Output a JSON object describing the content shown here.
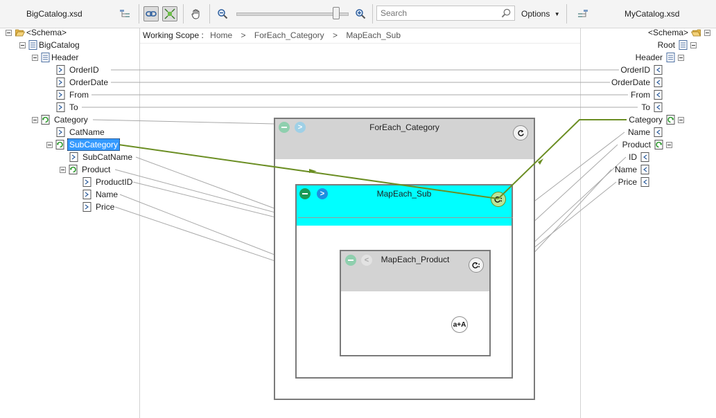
{
  "toolbar": {
    "left_schema_file": "BigCatalog.xsd",
    "right_schema_file": "MyCatalog.xsd",
    "search_placeholder": "Search",
    "options_label": "Options",
    "zoom_level": 0.9
  },
  "scope": {
    "label": "Working Scope :",
    "crumbs": [
      "Home",
      "ForEach_Category",
      "MapEach_Sub"
    ]
  },
  "left_tree": {
    "schema": "<Schema>",
    "root": "BigCatalog",
    "header": "Header",
    "order_id": "OrderID",
    "order_date": "OrderDate",
    "from": "From",
    "to": "To",
    "category": "Category",
    "cat_name": "CatName",
    "sub_category": "SubCategory",
    "sub_cat_name": "SubCatName",
    "product": "Product",
    "product_id": "ProductID",
    "name": "Name",
    "price": "Price"
  },
  "right_tree": {
    "schema": "<Schema>",
    "root": "Root",
    "header": "Header",
    "order_id": "OrderID",
    "order_date": "OrderDate",
    "from": "From",
    "to": "To",
    "category": "Category",
    "name": "Name",
    "product": "Product",
    "id": "ID",
    "product_name": "Name",
    "price": "Price"
  },
  "shapes": {
    "foreach_category": "ForEach_Category",
    "mapeach_sub": "MapEach_Sub",
    "mapeach_product": "MapEach_Product",
    "concat_label": "a+A"
  },
  "colors": {
    "active_link": "#6b8e23",
    "link": "#a8a8a8",
    "scope_header_active": "#00ffff",
    "scope_header_inactive": "#d3d3d3",
    "selection": "#3399ff"
  }
}
